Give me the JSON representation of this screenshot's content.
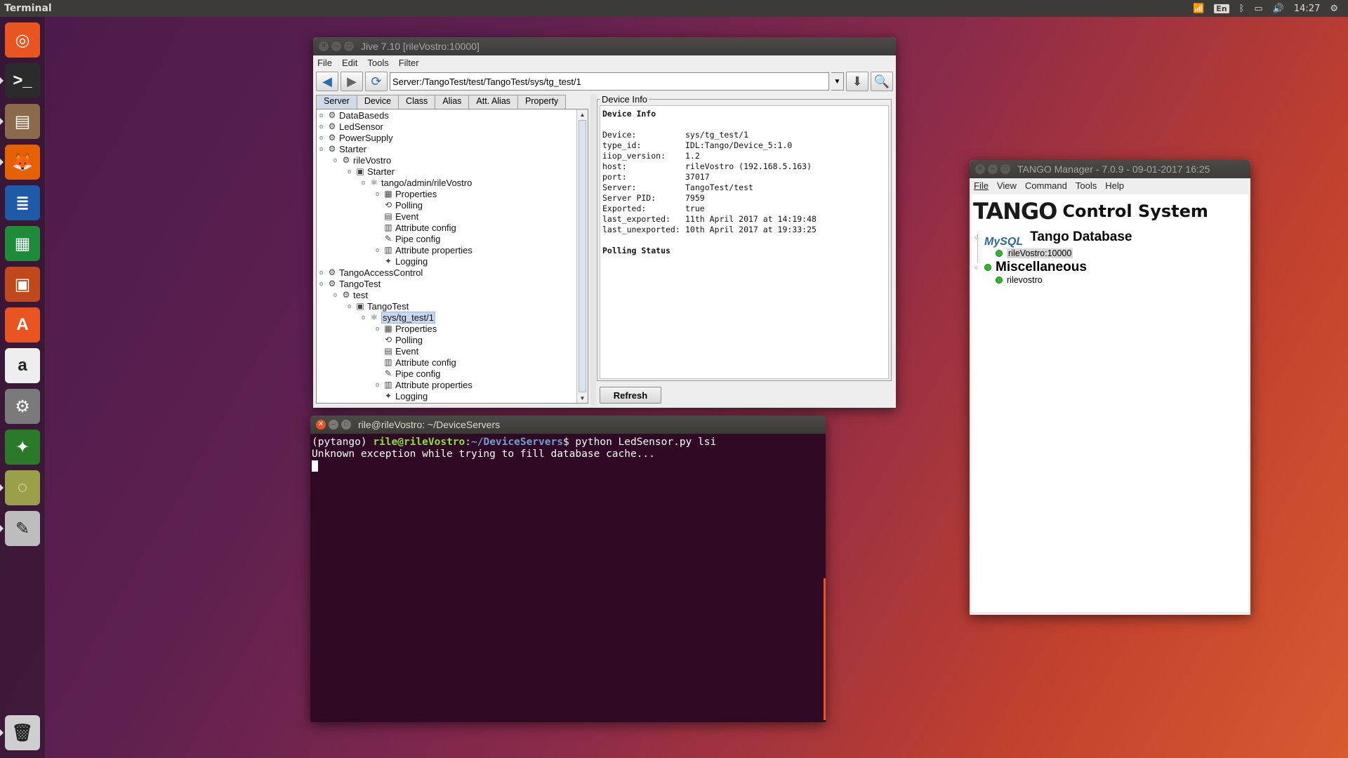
{
  "topbar": {
    "app_title": "Terminal",
    "keyboard_layout": "En",
    "clock": "14:27"
  },
  "launcher": {
    "items": [
      {
        "name": "ubuntu-home-icon",
        "color": "#e95420",
        "glyph": "◎"
      },
      {
        "name": "terminal-icon",
        "color": "#2b2b2b",
        "glyph": ">_"
      },
      {
        "name": "files-icon",
        "color": "#8a6a4a",
        "glyph": "▤"
      },
      {
        "name": "firefox-icon",
        "color": "#e66000",
        "glyph": "🦊"
      },
      {
        "name": "writer-icon",
        "color": "#1d5aa8",
        "glyph": "≣"
      },
      {
        "name": "calc-icon",
        "color": "#1e8a3a",
        "glyph": "▦"
      },
      {
        "name": "impress-icon",
        "color": "#c0481a",
        "glyph": "▣"
      },
      {
        "name": "software-center-icon",
        "color": "#e95420",
        "glyph": "A"
      },
      {
        "name": "amazon-icon",
        "color": "#eeeeee",
        "glyph": "a"
      },
      {
        "name": "settings-icon",
        "color": "#7a7a7a",
        "glyph": "⚙"
      },
      {
        "name": "tango-icon",
        "color": "#2a7a2a",
        "glyph": "✦"
      },
      {
        "name": "jive-icon",
        "color": "#9aa04a",
        "glyph": "◌"
      },
      {
        "name": "text-editor-icon",
        "color": "#bdbdbd",
        "glyph": "✎"
      },
      {
        "name": "trash-icon",
        "color": "#cfcfcf",
        "glyph": "🗑"
      }
    ]
  },
  "jive": {
    "title": "Jive 7.10 [rileVostro:10000]",
    "menu": [
      "File",
      "Edit",
      "Tools",
      "Filter"
    ],
    "address": "Server:/TangoTest/test/TangoTest/sys/tg_test/1",
    "tabs": [
      "Server",
      "Device",
      "Class",
      "Alias",
      "Att. Alias",
      "Property"
    ],
    "tree": [
      {
        "label": "DataBaseds",
        "depth": 0,
        "icon": "server"
      },
      {
        "label": "LedSensor",
        "depth": 0,
        "icon": "server"
      },
      {
        "label": "PowerSupply",
        "depth": 0,
        "icon": "server"
      },
      {
        "label": "Starter",
        "depth": 0,
        "icon": "server"
      },
      {
        "label": "rileVostro",
        "depth": 1,
        "icon": "server"
      },
      {
        "label": "Starter",
        "depth": 2,
        "icon": "class"
      },
      {
        "label": "tango/admin/rileVostro",
        "depth": 3,
        "icon": "device"
      },
      {
        "label": "Properties",
        "depth": 4,
        "icon": "props"
      },
      {
        "label": "Polling",
        "depth": 4,
        "icon": "poll"
      },
      {
        "label": "Event",
        "depth": 4,
        "icon": "event"
      },
      {
        "label": "Attribute config",
        "depth": 4,
        "icon": "attr"
      },
      {
        "label": "Pipe config",
        "depth": 4,
        "icon": "pipe"
      },
      {
        "label": "Attribute properties",
        "depth": 4,
        "icon": "attr"
      },
      {
        "label": "Logging",
        "depth": 4,
        "icon": "log"
      },
      {
        "label": "TangoAccessControl",
        "depth": 0,
        "icon": "server"
      },
      {
        "label": "TangoTest",
        "depth": 0,
        "icon": "server"
      },
      {
        "label": "test",
        "depth": 1,
        "icon": "server"
      },
      {
        "label": "TangoTest",
        "depth": 2,
        "icon": "class"
      },
      {
        "label": "sys/tg_test/1",
        "depth": 3,
        "icon": "device",
        "selected": true
      },
      {
        "label": "Properties",
        "depth": 4,
        "icon": "props"
      },
      {
        "label": "Polling",
        "depth": 4,
        "icon": "poll"
      },
      {
        "label": "Event",
        "depth": 4,
        "icon": "event"
      },
      {
        "label": "Attribute config",
        "depth": 4,
        "icon": "attr"
      },
      {
        "label": "Pipe config",
        "depth": 4,
        "icon": "pipe"
      },
      {
        "label": "Attribute properties",
        "depth": 4,
        "icon": "attr"
      },
      {
        "label": "Logging",
        "depth": 4,
        "icon": "log"
      }
    ],
    "device_info_legend": "Device Info",
    "device_info_heading": "Device Info",
    "device_info_rows": [
      {
        "key": "Device:",
        "value": "sys/tg_test/1"
      },
      {
        "key": "type_id:",
        "value": "IDL:Tango/Device_5:1.0"
      },
      {
        "key": "iiop_version:",
        "value": "1.2"
      },
      {
        "key": "host:",
        "value": "rileVostro (192.168.5.163)"
      },
      {
        "key": "port:",
        "value": "37017"
      },
      {
        "key": "Server:",
        "value": "TangoTest/test"
      },
      {
        "key": "Server PID:",
        "value": "7959"
      },
      {
        "key": "Exported:",
        "value": "true"
      },
      {
        "key": "last_exported:",
        "value": "11th April 2017 at 14:19:48"
      },
      {
        "key": "last_unexported:",
        "value": "10th April 2017 at 19:33:25"
      }
    ],
    "polling_heading": "Polling Status",
    "refresh_label": "Refresh"
  },
  "terminal": {
    "title": "rile@rileVostro: ~/DeviceServers",
    "prompt_env": "(pytango) ",
    "prompt_user": "rile@rileVostro",
    "prompt_sep": ":",
    "prompt_path": "~/DeviceServers",
    "prompt_end": "$ ",
    "command": "python LedSensor.py lsi",
    "output": "Unknown exception while trying to fill database cache..."
  },
  "tango_manager": {
    "title": "TANGO Manager - 7.0.9  - 09-01-2017  16:25",
    "menu": [
      "File",
      "View",
      "Command",
      "Tools",
      "Help"
    ],
    "logo_text": "TANGO",
    "logo_subtitle": "Control System",
    "db_brand": "MySQL",
    "db_label": "Tango Database",
    "db_host": "rileVostro:10000",
    "misc_label": "Miscellaneous",
    "misc_host": "rilevostro"
  }
}
